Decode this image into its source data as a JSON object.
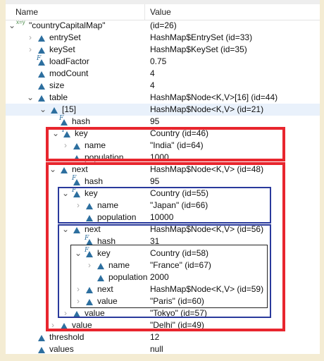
{
  "columns": {
    "name": "Name",
    "value": "Value"
  },
  "rows": [
    {
      "label": "\"countryCapitalMap\"",
      "value": "(id=26)"
    },
    {
      "label": "entrySet",
      "value": "HashMap$EntrySet  (id=33)"
    },
    {
      "label": "keySet",
      "value": "HashMap$KeySet  (id=35)"
    },
    {
      "label": "loadFactor",
      "value": "0.75"
    },
    {
      "label": "modCount",
      "value": "4"
    },
    {
      "label": "size",
      "value": "4"
    },
    {
      "label": "table",
      "value": "HashMap$Node<K,V>[16]  (id=44)"
    },
    {
      "label": "[15]",
      "value": "HashMap$Node<K,V>  (id=21)"
    },
    {
      "label": "hash",
      "value": "95"
    },
    {
      "label": "key",
      "value": "Country  (id=46)"
    },
    {
      "label": "name",
      "value": "\"India\" (id=64)"
    },
    {
      "label": "population",
      "value": "1000"
    },
    {
      "label": "next",
      "value": "HashMap$Node<K,V>  (id=48)"
    },
    {
      "label": "hash",
      "value": "95"
    },
    {
      "label": "key",
      "value": "Country  (id=55)"
    },
    {
      "label": "name",
      "value": "\"Japan\" (id=66)"
    },
    {
      "label": "population",
      "value": "10000"
    },
    {
      "label": "next",
      "value": "HashMap$Node<K,V>  (id=56)"
    },
    {
      "label": "hash",
      "value": "31"
    },
    {
      "label": "key",
      "value": "Country  (id=58)"
    },
    {
      "label": "name",
      "value": "\"France\" (id=67)"
    },
    {
      "label": "population",
      "value": "2000"
    },
    {
      "label": "next",
      "value": "HashMap$Node<K,V>  (id=59)"
    },
    {
      "label": "value",
      "value": "\"Paris\" (id=60)"
    },
    {
      "label": "value",
      "value": "\"Tokyo\" (id=57)"
    },
    {
      "label": "value",
      "value": "\"Delhi\" (id=49)"
    },
    {
      "label": "threshold",
      "value": "12"
    },
    {
      "label": "values",
      "value": "null"
    }
  ],
  "colors": {
    "red_box": "#e8262e",
    "blue_box": "#2a3a9c",
    "black_box": "#222222",
    "selected_row": "#e9f1fb",
    "field_icon": "#2d6f9f"
  }
}
